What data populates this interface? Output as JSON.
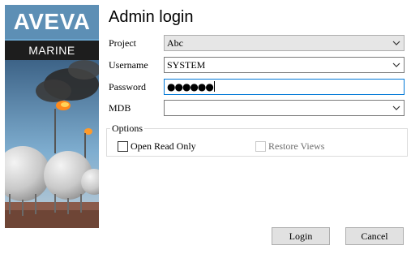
{
  "brand": {
    "name": "AVEVA",
    "sub": "MARINE"
  },
  "dialog": {
    "title": "Admin login"
  },
  "form": {
    "project_label": "Project",
    "project_value": "Abc",
    "username_label": "Username",
    "username_value": "SYSTEM",
    "password_label": "Password",
    "password_value": "●●●●●●",
    "mdb_label": "MDB",
    "mdb_value": ""
  },
  "options": {
    "legend": "Options",
    "open_read_only": {
      "label": "Open Read Only",
      "checked": false,
      "enabled": true
    },
    "restore_views": {
      "label": "Restore Views",
      "checked": false,
      "enabled": false
    }
  },
  "buttons": {
    "login": "Login",
    "cancel": "Cancel"
  },
  "colors": {
    "focus_border": "#0078d7",
    "logo_blue": "#5d8fb5",
    "button_bg": "#e1e1e1"
  },
  "icons": {
    "dropdown": "chevron-down-icon"
  }
}
